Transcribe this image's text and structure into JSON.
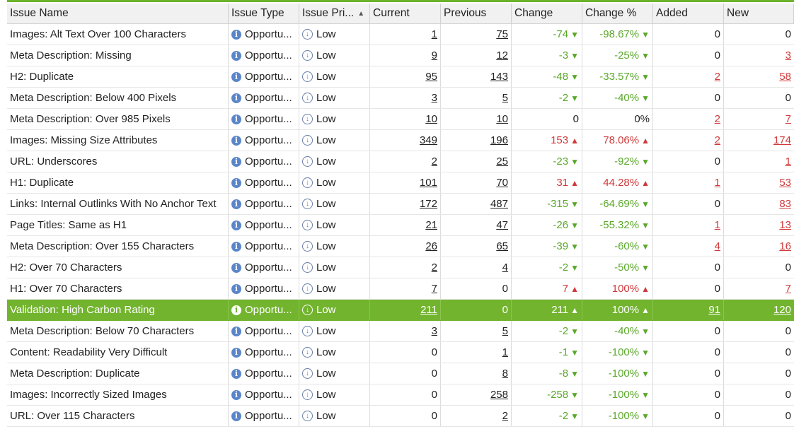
{
  "columns": [
    "Issue Name",
    "Issue Type",
    "Issue Pri...",
    "Current",
    "Previous",
    "Change",
    "Change %",
    "Added",
    "New"
  ],
  "sort_indicator": "▲",
  "type_label": "Opportu...",
  "priority_label": "Low",
  "icons": {
    "type": "info-icon",
    "priority": "low-priority-icon",
    "down": "down-triangle",
    "up": "up-triangle"
  },
  "colors": {
    "accent": "#6ab32b",
    "selected_row": "#72b42e",
    "decrease": "#5aa82a",
    "increase": "#d0393b",
    "link_red": "#d0393b"
  },
  "selected_index": 13,
  "rows": [
    {
      "name": "Images: Alt Text Over 100 Characters",
      "current": "1",
      "previous": "75",
      "change": "-74",
      "pct": "-98.67%",
      "dir": "down",
      "added": "0",
      "new": "0"
    },
    {
      "name": "Meta Description: Missing",
      "current": "9",
      "previous": "12",
      "change": "-3",
      "pct": "-25%",
      "dir": "down",
      "added": "0",
      "new": "3"
    },
    {
      "name": "H2: Duplicate",
      "current": "95",
      "previous": "143",
      "change": "-48",
      "pct": "-33.57%",
      "dir": "down",
      "added": "2",
      "new": "58"
    },
    {
      "name": "Meta Description: Below 400 Pixels",
      "current": "3",
      "previous": "5",
      "change": "-2",
      "pct": "-40%",
      "dir": "down",
      "added": "0",
      "new": "0"
    },
    {
      "name": "Meta Description: Over 985 Pixels",
      "current": "10",
      "previous": "10",
      "change": "0",
      "pct": "0%",
      "dir": "none",
      "added": "2",
      "new": "7"
    },
    {
      "name": "Images: Missing Size Attributes",
      "current": "349",
      "previous": "196",
      "change": "153",
      "pct": "78.06%",
      "dir": "up",
      "added": "2",
      "new": "174"
    },
    {
      "name": "URL: Underscores",
      "current": "2",
      "previous": "25",
      "change": "-23",
      "pct": "-92%",
      "dir": "down",
      "added": "0",
      "new": "1"
    },
    {
      "name": "H1: Duplicate",
      "current": "101",
      "previous": "70",
      "change": "31",
      "pct": "44.28%",
      "dir": "up",
      "added": "1",
      "new": "53"
    },
    {
      "name": "Links: Internal Outlinks With No Anchor Text",
      "current": "172",
      "previous": "487",
      "change": "-315",
      "pct": "-64.69%",
      "dir": "down",
      "added": "0",
      "new": "83"
    },
    {
      "name": "Page Titles: Same as H1",
      "current": "21",
      "previous": "47",
      "change": "-26",
      "pct": "-55.32%",
      "dir": "down",
      "added": "1",
      "new": "13"
    },
    {
      "name": "Meta Description: Over 155 Characters",
      "current": "26",
      "previous": "65",
      "change": "-39",
      "pct": "-60%",
      "dir": "down",
      "added": "4",
      "new": "16"
    },
    {
      "name": "H2: Over 70 Characters",
      "current": "2",
      "previous": "4",
      "change": "-2",
      "pct": "-50%",
      "dir": "down",
      "added": "0",
      "new": "0"
    },
    {
      "name": "H1: Over 70 Characters",
      "current": "7",
      "previous": "0",
      "change": "7",
      "pct": "100%",
      "dir": "up",
      "added": "0",
      "new": "7"
    },
    {
      "name": "Validation: High Carbon Rating",
      "current": "211",
      "previous": "0",
      "change": "211",
      "pct": "100%",
      "dir": "up",
      "added": "91",
      "new": "120"
    },
    {
      "name": "Meta Description: Below 70 Characters",
      "current": "3",
      "previous": "5",
      "change": "-2",
      "pct": "-40%",
      "dir": "down",
      "added": "0",
      "new": "0"
    },
    {
      "name": "Content: Readability Very Difficult",
      "current": "0",
      "previous": "1",
      "change": "-1",
      "pct": "-100%",
      "dir": "down",
      "added": "0",
      "new": "0"
    },
    {
      "name": "Meta Description: Duplicate",
      "current": "0",
      "previous": "8",
      "change": "-8",
      "pct": "-100%",
      "dir": "down",
      "added": "0",
      "new": "0"
    },
    {
      "name": "Images: Incorrectly Sized Images",
      "current": "0",
      "previous": "258",
      "change": "-258",
      "pct": "-100%",
      "dir": "down",
      "added": "0",
      "new": "0"
    },
    {
      "name": "URL: Over 115 Characters",
      "current": "0",
      "previous": "2",
      "change": "-2",
      "pct": "-100%",
      "dir": "down",
      "added": "0",
      "new": "0"
    }
  ]
}
